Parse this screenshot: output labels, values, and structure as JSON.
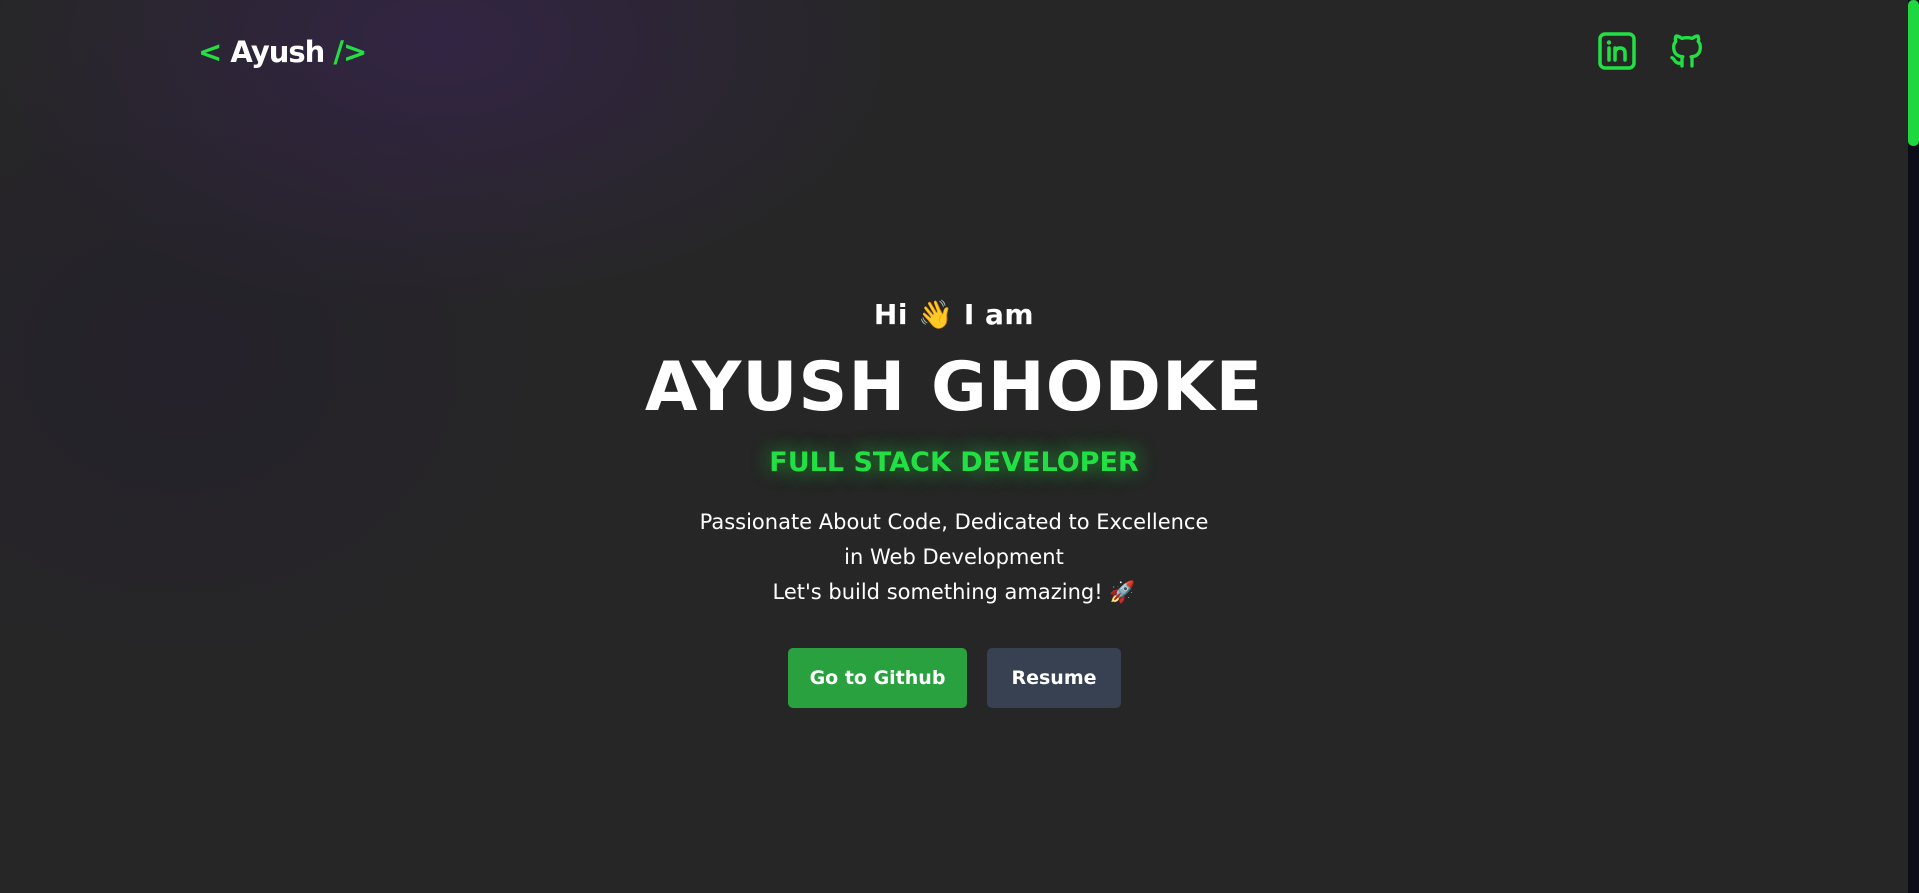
{
  "header": {
    "logo": {
      "open": "<",
      "name": "Ayush",
      "close": "/>"
    },
    "social": [
      {
        "icon": "linkedin-icon"
      },
      {
        "icon": "github-icon"
      }
    ]
  },
  "hero": {
    "greeting": "Hi 👋 I am",
    "name": "AYUSH GHODKE",
    "role": "FULL STACK DEVELOPER",
    "tagline": [
      "Passionate About Code, Dedicated to Excellence",
      "in Web Development",
      "Let's build something amazing! 🚀"
    ],
    "buttons": {
      "github_label": "Go to Github",
      "resume_label": "Resume"
    }
  },
  "colors": {
    "accent": "#22e043",
    "background": "#262626",
    "github_button": "#28a13e",
    "resume_button": "#374152"
  },
  "scrollbar": {
    "position_fraction": 0.0
  }
}
